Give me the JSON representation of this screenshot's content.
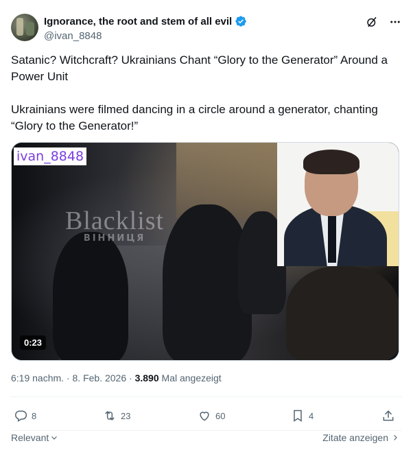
{
  "author": {
    "display_name": "Ignorance, the root and stem of all evil",
    "handle": "@ivan_8848",
    "verified": true,
    "avatar_icon": "avatar"
  },
  "header_icons": [
    "grok-icon",
    "more-icon"
  ],
  "post": {
    "paragraphs": [
      "Satanic? Witchcraft? Ukrainians Chant “Glory to the Generator” Around a Power Unit",
      "Ukrainians were filmed dancing in a circle around a generator, chanting “Glory to the Generator!”"
    ]
  },
  "media": {
    "type": "video",
    "overlay_tag": "ivan_8848",
    "watermark_main": "Blacklist",
    "watermark_sub": "ВІННИЦЯ",
    "duration": "0:23"
  },
  "meta": {
    "time": "6:19 nachm.",
    "separator": "·",
    "date": "8. Feb. 2026",
    "views_count": "3.890",
    "views_label": "Mal angezeigt"
  },
  "actions": {
    "replies": "8",
    "reposts": "23",
    "likes": "60",
    "bookmarks": "4"
  },
  "footer": {
    "sort_label": "Relevant",
    "quotes_label": "Zitate anzeigen"
  },
  "colors": {
    "text_primary": "#0f1419",
    "text_secondary": "#536471",
    "verified_blue": "#1d9bf0",
    "tag_purple": "#7a3fe0"
  }
}
